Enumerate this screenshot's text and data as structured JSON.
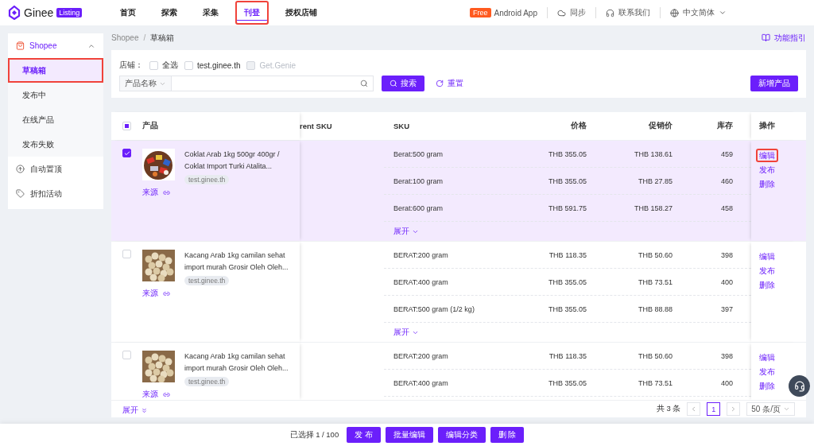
{
  "header": {
    "logo": {
      "name": "Ginee",
      "badge": "Listing"
    },
    "nav": [
      {
        "label": "首页",
        "selected": false,
        "highlighted": false
      },
      {
        "label": "探索",
        "selected": false,
        "highlighted": false
      },
      {
        "label": "采集",
        "selected": false,
        "highlighted": false
      },
      {
        "label": "刊登",
        "selected": true,
        "highlighted": true
      },
      {
        "label": "授权店铺",
        "selected": false,
        "highlighted": false
      }
    ],
    "promo": {
      "badge": "Free",
      "label": "Android App"
    },
    "actions": [
      {
        "label": "同步",
        "kind": "sync"
      },
      {
        "label": "联系我们",
        "kind": "support"
      },
      {
        "label": "中文简体",
        "kind": "language"
      }
    ]
  },
  "sidebar": {
    "group": {
      "label": "Shopee",
      "expanded": true,
      "items": [
        {
          "label": "草稿箱",
          "selected": true,
          "highlighted": true
        },
        {
          "label": "发布中",
          "selected": false,
          "highlighted": false
        },
        {
          "label": "在线产品",
          "selected": false,
          "highlighted": false
        },
        {
          "label": "发布失败",
          "selected": false,
          "highlighted": false
        }
      ]
    },
    "items": [
      {
        "label": "自动置顶",
        "kind": "top"
      },
      {
        "label": "折扣活动",
        "kind": "discount"
      }
    ]
  },
  "breadcrumb": [
    "Shopee",
    "草稿箱"
  ],
  "breadcrumb_separator": "/",
  "guide_link": "功能指引",
  "filter": {
    "store_label": "店铺：",
    "stores": [
      {
        "label": "全选",
        "checked": false,
        "disabled": false
      },
      {
        "label": "test.ginee.th",
        "checked": false,
        "disabled": false
      },
      {
        "label": "Get.Genie",
        "checked": false,
        "disabled": true
      }
    ],
    "field_select": "产品名称",
    "search_button": "搜索",
    "reset_button": "重置",
    "add_button": "新增产品"
  },
  "table": {
    "select_all": {
      "indeterminate": true
    },
    "columns": {
      "product": "产品",
      "column_2": "rent SKU",
      "sku": "SKU",
      "price": "价格",
      "promo_price": "促销价",
      "stock": "库存",
      "actions": "操作"
    },
    "rows": [
      {
        "selected": true,
        "title": "Coklat Arab 1kg 500gr 400gr / Coklat Import Turki Atalita...",
        "store": "test.ginee.th",
        "source": "来源",
        "expand": "展开",
        "skus": [
          {
            "sku": "Berat:500 gram",
            "price": "THB 355.05",
            "promo_price": "THB 138.61",
            "stock": "459"
          },
          {
            "sku": "Berat:100 gram",
            "price": "THB 355.05",
            "promo_price": "THB 27.85",
            "stock": "460"
          },
          {
            "sku": "Berat:600 gram",
            "price": "THB 591.75",
            "promo_price": "THB 158.27",
            "stock": "458"
          }
        ],
        "actions": [
          {
            "label": "编辑",
            "highlighted": true
          },
          {
            "label": "发布",
            "highlighted": false
          },
          {
            "label": "删除",
            "highlighted": false
          }
        ]
      },
      {
        "selected": false,
        "title": "Kacang Arab 1kg camilan sehat import murah Grosir Oleh Oleh...",
        "store": "test.ginee.th",
        "source": "来源",
        "expand": "展开",
        "skus": [
          {
            "sku": "BERAT:200 gram",
            "price": "THB 118.35",
            "promo_price": "THB 50.60",
            "stock": "398"
          },
          {
            "sku": "BERAT:400 gram",
            "price": "THB 355.05",
            "promo_price": "THB 73.51",
            "stock": "400"
          },
          {
            "sku": "BERAT:500 gram (1/2 kg)",
            "price": "THB 355.05",
            "promo_price": "THB 88.88",
            "stock": "397"
          }
        ],
        "actions": [
          {
            "label": "编辑",
            "highlighted": false
          },
          {
            "label": "发布",
            "highlighted": false
          },
          {
            "label": "删除",
            "highlighted": false
          }
        ]
      },
      {
        "selected": false,
        "title": "Kacang Arab 1kg camilan sehat import murah Grosir Oleh Oleh...",
        "store": "test.ginee.th",
        "source": "来源",
        "skus": [
          {
            "sku": "BERAT:200 gram",
            "price": "THB 118.35",
            "promo_price": "THB 50.60",
            "stock": "398"
          },
          {
            "sku": "BERAT:400 gram",
            "price": "THB 355.05",
            "promo_price": "THB 73.51",
            "stock": "400"
          }
        ],
        "actions": [
          {
            "label": "编辑",
            "highlighted": false
          },
          {
            "label": "发布",
            "highlighted": false
          },
          {
            "label": "删除",
            "highlighted": false
          }
        ]
      }
    ]
  },
  "table_footer": {
    "expand": "展开",
    "total": "共 3 条",
    "pages": [
      {
        "label": "1",
        "selected": true
      }
    ],
    "page_size": "50 条/页"
  },
  "bottom_bar": {
    "selection": "已选择 1 / 100",
    "buttons": [
      "发 布",
      "批量编辑",
      "编辑分类",
      "删 除"
    ]
  }
}
